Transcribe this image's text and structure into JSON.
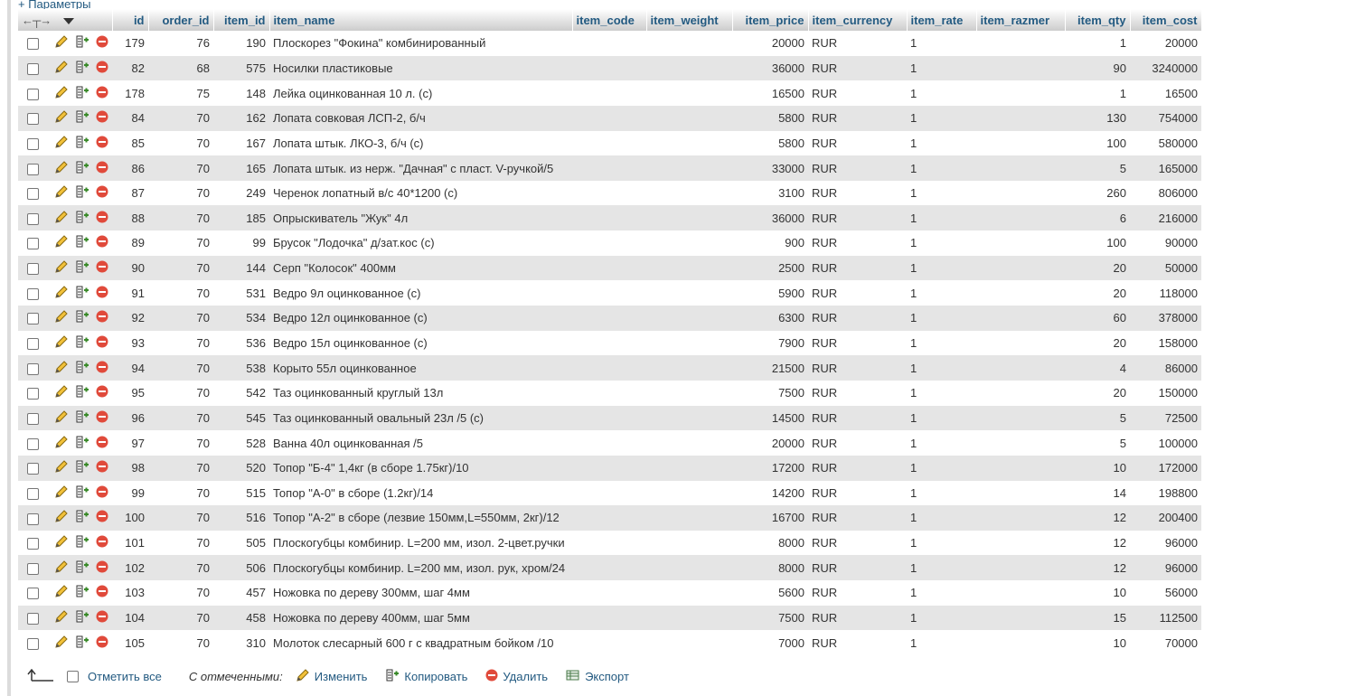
{
  "top_link": "+ Параметры",
  "columns": [
    "id",
    "order_id",
    "item_id",
    "item_name",
    "item_code",
    "item_weight",
    "item_price",
    "item_currency",
    "item_rate",
    "item_razmer",
    "item_qty",
    "item_cost"
  ],
  "rows": [
    {
      "id": "179",
      "order_id": "76",
      "item_id": "190",
      "item_name": "Плоскорез \"Фокина\" комбинированный",
      "item_price": "20000",
      "item_currency": "RUR",
      "item_rate": "1",
      "item_qty": "1",
      "item_cost": "20000"
    },
    {
      "id": "82",
      "order_id": "68",
      "item_id": "575",
      "item_name": "Носилки пластиковые",
      "item_price": "36000",
      "item_currency": "RUR",
      "item_rate": "1",
      "item_qty": "90",
      "item_cost": "3240000"
    },
    {
      "id": "178",
      "order_id": "75",
      "item_id": "148",
      "item_name": "Лейка оцинкованная 10 л. (с)",
      "item_price": "16500",
      "item_currency": "RUR",
      "item_rate": "1",
      "item_qty": "1",
      "item_cost": "16500"
    },
    {
      "id": "84",
      "order_id": "70",
      "item_id": "162",
      "item_name": "Лопата совковая ЛСП-2, б/ч",
      "item_price": "5800",
      "item_currency": "RUR",
      "item_rate": "1",
      "item_qty": "130",
      "item_cost": "754000"
    },
    {
      "id": "85",
      "order_id": "70",
      "item_id": "167",
      "item_name": "Лопата штык. ЛКО-3, б/ч (с)",
      "item_price": "5800",
      "item_currency": "RUR",
      "item_rate": "1",
      "item_qty": "100",
      "item_cost": "580000"
    },
    {
      "id": "86",
      "order_id": "70",
      "item_id": "165",
      "item_name": "Лопата штык. из нерж. \"Дачная\" с пласт. V-ручкой/5",
      "item_price": "33000",
      "item_currency": "RUR",
      "item_rate": "1",
      "item_qty": "5",
      "item_cost": "165000"
    },
    {
      "id": "87",
      "order_id": "70",
      "item_id": "249",
      "item_name": "Черенок лопатный в/с 40*1200 (с)",
      "item_price": "3100",
      "item_currency": "RUR",
      "item_rate": "1",
      "item_qty": "260",
      "item_cost": "806000"
    },
    {
      "id": "88",
      "order_id": "70",
      "item_id": "185",
      "item_name": "Опрыскиватель \"Жук\"  4л",
      "item_price": "36000",
      "item_currency": "RUR",
      "item_rate": "1",
      "item_qty": "6",
      "item_cost": "216000"
    },
    {
      "id": "89",
      "order_id": "70",
      "item_id": "99",
      "item_name": "Брусок \"Лодочка\" д/зат.кос  (с)",
      "item_price": "900",
      "item_currency": "RUR",
      "item_rate": "1",
      "item_qty": "100",
      "item_cost": "90000"
    },
    {
      "id": "90",
      "order_id": "70",
      "item_id": "144",
      "item_name": "Серп \"Колосок\" 400мм",
      "item_price": "2500",
      "item_currency": "RUR",
      "item_rate": "1",
      "item_qty": "20",
      "item_cost": "50000"
    },
    {
      "id": "91",
      "order_id": "70",
      "item_id": "531",
      "item_name": "Ведро  9л оцинкованное (с)",
      "item_price": "5900",
      "item_currency": "RUR",
      "item_rate": "1",
      "item_qty": "20",
      "item_cost": "118000"
    },
    {
      "id": "92",
      "order_id": "70",
      "item_id": "534",
      "item_name": "Ведро 12л оцинкованное (с)",
      "item_price": "6300",
      "item_currency": "RUR",
      "item_rate": "1",
      "item_qty": "60",
      "item_cost": "378000"
    },
    {
      "id": "93",
      "order_id": "70",
      "item_id": "536",
      "item_name": "Ведро 15л оцинкованное (с)",
      "item_price": "7900",
      "item_currency": "RUR",
      "item_rate": "1",
      "item_qty": "20",
      "item_cost": "158000"
    },
    {
      "id": "94",
      "order_id": "70",
      "item_id": "538",
      "item_name": "Корыто 55л оцинкованное",
      "item_price": "21500",
      "item_currency": "RUR",
      "item_rate": "1",
      "item_qty": "4",
      "item_cost": "86000"
    },
    {
      "id": "95",
      "order_id": "70",
      "item_id": "542",
      "item_name": "Таз оцинкованный круглый 13л",
      "item_price": "7500",
      "item_currency": "RUR",
      "item_rate": "1",
      "item_qty": "20",
      "item_cost": "150000"
    },
    {
      "id": "96",
      "order_id": "70",
      "item_id": "545",
      "item_name": "Таз оцинкованный овальный 23л /5 (с)",
      "item_price": "14500",
      "item_currency": "RUR",
      "item_rate": "1",
      "item_qty": "5",
      "item_cost": "72500"
    },
    {
      "id": "97",
      "order_id": "70",
      "item_id": "528",
      "item_name": "Ванна 40л оцинкованная /5",
      "item_price": "20000",
      "item_currency": "RUR",
      "item_rate": "1",
      "item_qty": "5",
      "item_cost": "100000"
    },
    {
      "id": "98",
      "order_id": "70",
      "item_id": "520",
      "item_name": "Топор \"Б-4\" 1,4кг (в сборе 1.75кг)/10",
      "item_price": "17200",
      "item_currency": "RUR",
      "item_rate": "1",
      "item_qty": "10",
      "item_cost": "172000"
    },
    {
      "id": "99",
      "order_id": "70",
      "item_id": "515",
      "item_name": "Топор \"А-0\" в сборе (1.2кг)/14",
      "item_price": "14200",
      "item_currency": "RUR",
      "item_rate": "1",
      "item_qty": "14",
      "item_cost": "198800"
    },
    {
      "id": "100",
      "order_id": "70",
      "item_id": "516",
      "item_name": "Топор \"А-2\" в сборе (лезвие 150мм,L=550мм, 2кг)/12",
      "item_price": "16700",
      "item_currency": "RUR",
      "item_rate": "1",
      "item_qty": "12",
      "item_cost": "200400"
    },
    {
      "id": "101",
      "order_id": "70",
      "item_id": "505",
      "item_name": "Плоскогубцы комбинир. L=200 мм, изол. 2-цвет.ручки",
      "item_price": "8000",
      "item_currency": "RUR",
      "item_rate": "1",
      "item_qty": "12",
      "item_cost": "96000"
    },
    {
      "id": "102",
      "order_id": "70",
      "item_id": "506",
      "item_name": "Плоскогубцы комбинир. L=200 мм, изол. рук, хром/24",
      "item_price": "8000",
      "item_currency": "RUR",
      "item_rate": "1",
      "item_qty": "12",
      "item_cost": "96000"
    },
    {
      "id": "103",
      "order_id": "70",
      "item_id": "457",
      "item_name": "Ножовка по дереву 300мм, шаг 4мм",
      "item_price": "5600",
      "item_currency": "RUR",
      "item_rate": "1",
      "item_qty": "10",
      "item_cost": "56000"
    },
    {
      "id": "104",
      "order_id": "70",
      "item_id": "458",
      "item_name": "Ножовка по дереву 400мм, шаг 5мм",
      "item_price": "7500",
      "item_currency": "RUR",
      "item_rate": "1",
      "item_qty": "15",
      "item_cost": "112500"
    },
    {
      "id": "105",
      "order_id": "70",
      "item_id": "310",
      "item_name": "Молоток слесарный  600 г с квадратным бойком /10",
      "item_price": "7000",
      "item_currency": "RUR",
      "item_rate": "1",
      "item_qty": "10",
      "item_cost": "70000"
    }
  ],
  "footer": {
    "check_all": "Отметить все",
    "with_selected": "С отмеченными:",
    "edit": "Изменить",
    "copy": "Копировать",
    "delete": "Удалить",
    "export": "Экспорт"
  },
  "colors": {
    "header_text": "#235a81",
    "row_alt": "#e5e5e5",
    "delete_red": "#e04a3b"
  }
}
